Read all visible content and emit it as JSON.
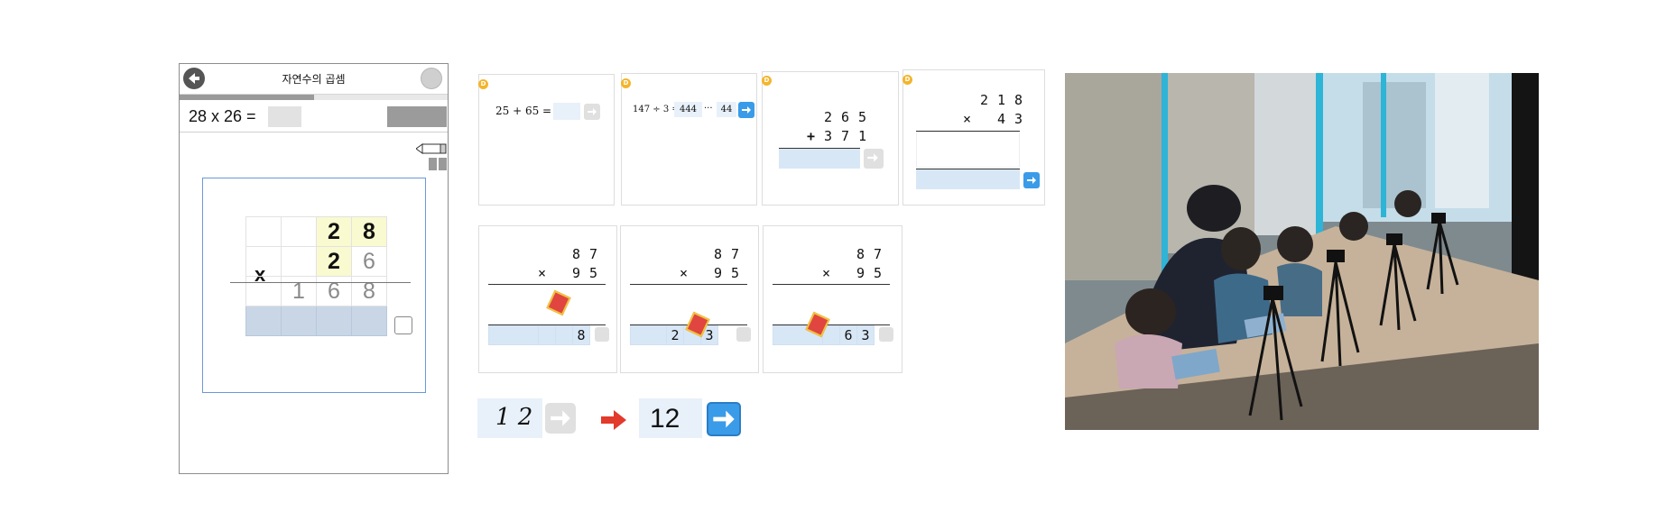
{
  "app": {
    "title": "자연수의 곱셈",
    "progress_fraction": 0.5,
    "problem_text": "28 x 26 =",
    "work": {
      "operator": "x",
      "row1": [
        "",
        "",
        "2",
        "8"
      ],
      "row2": [
        "",
        "",
        "2",
        "6"
      ],
      "row3": [
        "",
        "1",
        "6",
        "8"
      ]
    }
  },
  "examples": {
    "badge": "D",
    "card1_expr": "25 + 65 =",
    "card2_expr": "147 ÷ 3 =",
    "card2_quot": "444",
    "card2_sep": "···",
    "card2_rem": "44",
    "card3": {
      "row1": [
        "2",
        "6",
        "5"
      ],
      "op": "+",
      "row2": [
        "3",
        "7",
        "1"
      ]
    },
    "card4": {
      "row1": [
        "2",
        "1",
        "8"
      ],
      "op": "×",
      "row2": [
        "4",
        "3"
      ]
    },
    "erase": {
      "row1": [
        "8",
        "7"
      ],
      "op": "×",
      "row2": [
        "9",
        "5"
      ],
      "ans_a": [
        "",
        "",
        "",
        "8"
      ],
      "ans_b": [
        "",
        "2",
        "",
        "3"
      ],
      "ans_c": [
        "",
        "",
        "6",
        "3"
      ]
    },
    "recog_before": "1 2",
    "recog_after": "12"
  },
  "colors": {
    "accent_blue": "#3a9be8",
    "highlight_yellow": "#fafad0",
    "answer_blue": "#d8e7f6",
    "red_arrow": "#e23a2b"
  }
}
